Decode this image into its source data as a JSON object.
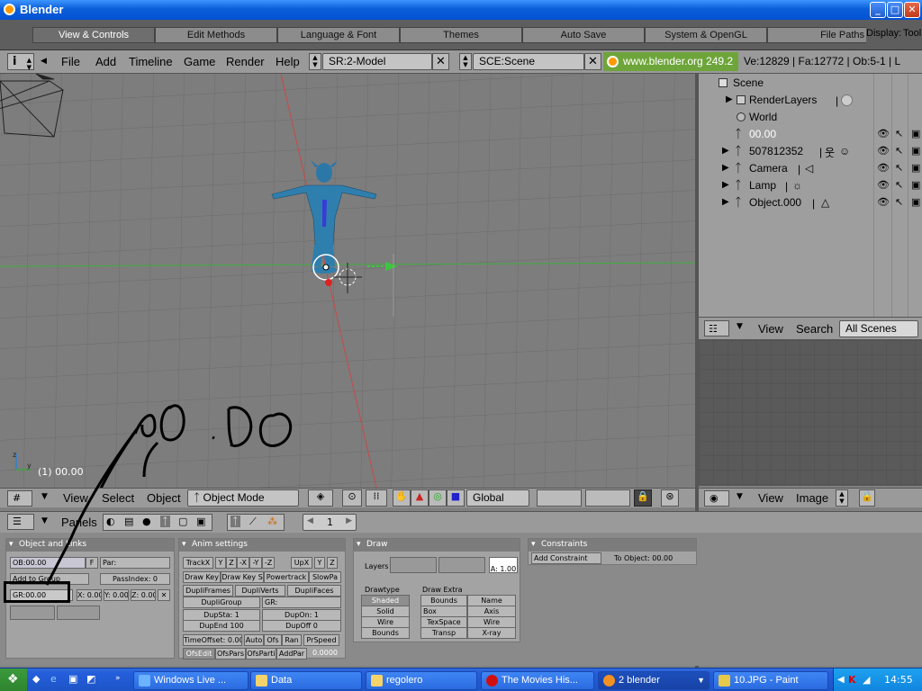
{
  "window": {
    "title": "Blender",
    "minimize": "_",
    "maximize": "□",
    "close": "✕"
  },
  "prefs_tabs": [
    "View & Controls",
    "Edit Methods",
    "Language & Font",
    "Themes",
    "Auto Save",
    "System & OpenGL",
    "File Paths",
    "Display:",
    "Tool Tips"
  ],
  "menus": [
    "File",
    "Add",
    "Timeline",
    "Game",
    "Render",
    "Help"
  ],
  "screen_field": "SR:2-Model",
  "scene_field": "SCE:Scene",
  "url_version": "www.blender.org 249.2",
  "stats": "Ve:12829 | Fa:12772 | Ob:5-1 | L",
  "view3d": {
    "frame_label": "(1) 00.00",
    "handwriting": "00.00"
  },
  "outliner": {
    "rows": [
      "Scene",
      "RenderLayers",
      "World",
      "00.00",
      "507812352",
      "Camera",
      "Lamp",
      "Object.000"
    ],
    "header_menus": [
      "View",
      "Search"
    ],
    "scope": "All Scenes"
  },
  "view3d_header": {
    "menus": [
      "View",
      "Select",
      "Object"
    ],
    "mode": "Object Mode",
    "orientation": "Global"
  },
  "image_header": {
    "menus": [
      "View",
      "Image"
    ]
  },
  "buttons_header": {
    "label": "Panels",
    "frame": "1"
  },
  "panels": {
    "object": {
      "title": "Object and Links",
      "ob": "OB:00.00",
      "f": "F",
      "par": "Par:",
      "add_group": "Add to Group",
      "passindex": "PassIndex: 0",
      "gr": "GR:00.00",
      "x": "X: 0.00",
      "y": "Y: 0.00",
      "z": "Z: 0.00",
      "xbtn": "✕"
    },
    "anim": {
      "title": "Anim settings",
      "trackx": "TrackX",
      "axes": [
        "Y",
        "Z",
        "-X",
        "-Y",
        "-Z"
      ],
      "upx": "UpX",
      "upaxes": [
        "Y",
        "Z"
      ],
      "row2": [
        "Draw Key",
        "Draw Key S",
        "Powertrack",
        "SlowPa"
      ],
      "row3": [
        "DupliFrames",
        "DupliVerts",
        "DupliFaces"
      ],
      "dupligroup": "DupliGroup",
      "gr": "GR:",
      "dupsta": "DupSta: 1",
      "dupon": "DupOn: 1",
      "dupend": "DupEnd 100",
      "dupoff": "DupOff 0",
      "timeoffset": "TimeOffset: 0.00",
      "auto": "Auto",
      "ofs": "Ofs",
      "ran": "Ran",
      "prspeed": "PrSpeed",
      "ofsedit": "OfsEdit",
      "ofspars": "OfsPars",
      "ofsparti": "OfsParti",
      "addpar": "AddPar",
      "speedval": "0.0000"
    },
    "draw": {
      "title": "Draw",
      "layers": "Layers",
      "alpha": "A: 1.00",
      "drawtype": "Drawtype",
      "drawtypes": [
        "Shaded",
        "Solid",
        "Wire",
        "Bounds"
      ],
      "drawextra": "Draw Extra",
      "extra_left": [
        "Bounds",
        "Box",
        "TexSpace",
        "Transp"
      ],
      "extra_right": [
        "Name",
        "Axis",
        "Wire",
        "X-ray"
      ]
    },
    "constraints": {
      "title": "Constraints",
      "add": "Add Constraint",
      "to_object": "To Object: 00.00"
    }
  },
  "taskbar": {
    "tasks": [
      "Windows Live ...",
      "Data",
      "regolero",
      "The Movies His...",
      "2 blender",
      "10.JPG - Paint"
    ],
    "time": "14:55"
  }
}
